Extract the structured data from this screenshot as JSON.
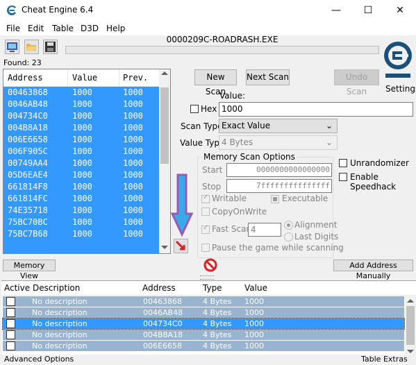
{
  "window": {
    "title": "Cheat Engine 6.4",
    "minimize_glyph": "—",
    "maximize_glyph": "☐",
    "close_glyph": "✕"
  },
  "menu": [
    "File",
    "Edit",
    "Table",
    "D3D",
    "Help"
  ],
  "toolbar": {
    "icons": [
      "process-select-icon",
      "open-file-icon",
      "save-icon"
    ]
  },
  "process": {
    "name": "0000209C-ROADRASH.EXE"
  },
  "found": {
    "label": "Found: 23"
  },
  "scan_results": {
    "columns": [
      "Address",
      "Value",
      "Prev."
    ],
    "rows": [
      {
        "address": "00463868",
        "value": "1000",
        "previous": "1000"
      },
      {
        "address": "0046AB48",
        "value": "1000",
        "previous": "1000"
      },
      {
        "address": "004734C0",
        "value": "1000",
        "previous": "1000"
      },
      {
        "address": "004B8A18",
        "value": "1000",
        "previous": "1000"
      },
      {
        "address": "006E6658",
        "value": "1000",
        "previous": "1000"
      },
      {
        "address": "006F905C",
        "value": "1000",
        "previous": "1000"
      },
      {
        "address": "00749AA4",
        "value": "1000",
        "previous": "1000"
      },
      {
        "address": "05D6EAE4",
        "value": "1000",
        "previous": "1000"
      },
      {
        "address": "661814F8",
        "value": "1000",
        "previous": "1000"
      },
      {
        "address": "661814FC",
        "value": "1000",
        "previous": "1000"
      },
      {
        "address": "74E35718",
        "value": "1000",
        "previous": "1000"
      },
      {
        "address": "75BC70BC",
        "value": "1000",
        "previous": "1000"
      },
      {
        "address": "75BC7B68",
        "value": "1000",
        "previous": "1000"
      }
    ],
    "selection_color": "#3399ff"
  },
  "buttons": {
    "new_scan": "New Scan",
    "next_scan": "Next Scan",
    "undo_scan": "Undo Scan",
    "memory_view": "Memory View",
    "add_address": "Add Address Manually"
  },
  "settings": {
    "label": "Settings",
    "logo_text": "Cheat Engine"
  },
  "value_section": {
    "label": "Value:",
    "hex_label": "Hex",
    "value": "1000"
  },
  "scan_type": {
    "label": "Scan Type",
    "selected": "Exact Value"
  },
  "value_type": {
    "label": "Value Type",
    "selected": "4 Bytes"
  },
  "memory_scan": {
    "title": "Memory Scan Options",
    "start_label": "Start",
    "start_value": "0000000000000000",
    "stop_label": "Stop",
    "stop_value": "7fffffffffffffff",
    "writable": "Writable",
    "executable": "Executable",
    "copyonwrite": "CopyOnWrite",
    "fast_scan": "Fast Scan",
    "fast_scan_value": "4",
    "alignment": "Alignment",
    "last_digits": "Last Digits",
    "pause": "Pause the game while scanning"
  },
  "options": {
    "unrandomizer": "Unrandomizer",
    "speedhack": "Enable Speedhack"
  },
  "address_list": {
    "columns": [
      "Active",
      "Description",
      "Address",
      "Type",
      "Value"
    ],
    "rows": [
      {
        "description": "No description",
        "address": "00463868",
        "type": "4 Bytes",
        "value": "1000"
      },
      {
        "description": "No description",
        "address": "0046AB48",
        "type": "4 Bytes",
        "value": "1000"
      },
      {
        "description": "No description",
        "address": "004734C0",
        "type": "4 Bytes",
        "value": "1000"
      },
      {
        "description": "No description",
        "address": "004B8A18",
        "type": "4 Bytes",
        "value": "1000"
      },
      {
        "description": "No description",
        "address": "006E6658",
        "type": "4 Bytes",
        "value": "1000"
      }
    ]
  },
  "bottom": {
    "advanced": "Advanced Options",
    "table_extras": "Table Extras"
  },
  "colors": {
    "accent": "#3399ff",
    "row_unfocused": "#99b4d1",
    "arrow_fill": "#3ba9e8",
    "arrow_outline": "#9b59b6",
    "stop_red": "#e02020"
  }
}
